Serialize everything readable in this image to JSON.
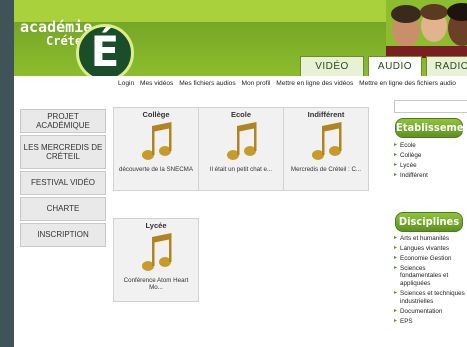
{
  "header": {
    "logo_line1": "académie",
    "logo_line2": "Créteil",
    "logo_letter": "É",
    "tabs": [
      {
        "label": "VIDÉO"
      },
      {
        "label": "AUDIO"
      },
      {
        "label": "RADIO"
      }
    ]
  },
  "topnav": {
    "items": [
      {
        "label": "Login"
      },
      {
        "label": "Mes vidéos"
      },
      {
        "label": "Mes fichiers audios"
      },
      {
        "label": "Mon profil"
      },
      {
        "label": "Mettre en ligne des vidéos"
      },
      {
        "label": "Mettre en ligne des fichiers audio"
      }
    ]
  },
  "sidebar": {
    "items": [
      {
        "label": "PROJET ACADÉMIQUE"
      },
      {
        "label": "LES MERCREDIS DE CRÉTEIL"
      },
      {
        "label": "FESTIVAL VIDÉO"
      },
      {
        "label": "CHARTE"
      },
      {
        "label": "INSCRIPTION"
      }
    ]
  },
  "cards": [
    {
      "title": "Collège",
      "label": "découverte de la SNECMA",
      "icon": "music-note-icon"
    },
    {
      "title": "Ecole",
      "label": "Il était un petit chat e...",
      "icon": "music-note-icon"
    },
    {
      "title": "Indifférent",
      "label": "Mercredis de Créteil : C...",
      "icon": "music-note-icon"
    },
    {
      "title": "Lycée",
      "label": "Conférence Atom Heart Mo...",
      "icon": "music-note-icon"
    }
  ],
  "etablissements": {
    "title": "Etablissements",
    "items": [
      "Ecole",
      "Collège",
      "Lycée",
      "Indifférent"
    ]
  },
  "disciplines": {
    "title": "Disciplines",
    "items": [
      "Arts et humanités",
      "Langues vivantes",
      "Economie Gestion",
      "Sciences fondamentales et appliquées",
      "Sciences et techniques industrielles",
      "Documentation",
      "EPS"
    ]
  },
  "colors": {
    "header_green": "#7db12a",
    "accent_green": "#5d9121",
    "sidebar_bg": "#3f5359",
    "note_gold": "#c89a2a"
  }
}
